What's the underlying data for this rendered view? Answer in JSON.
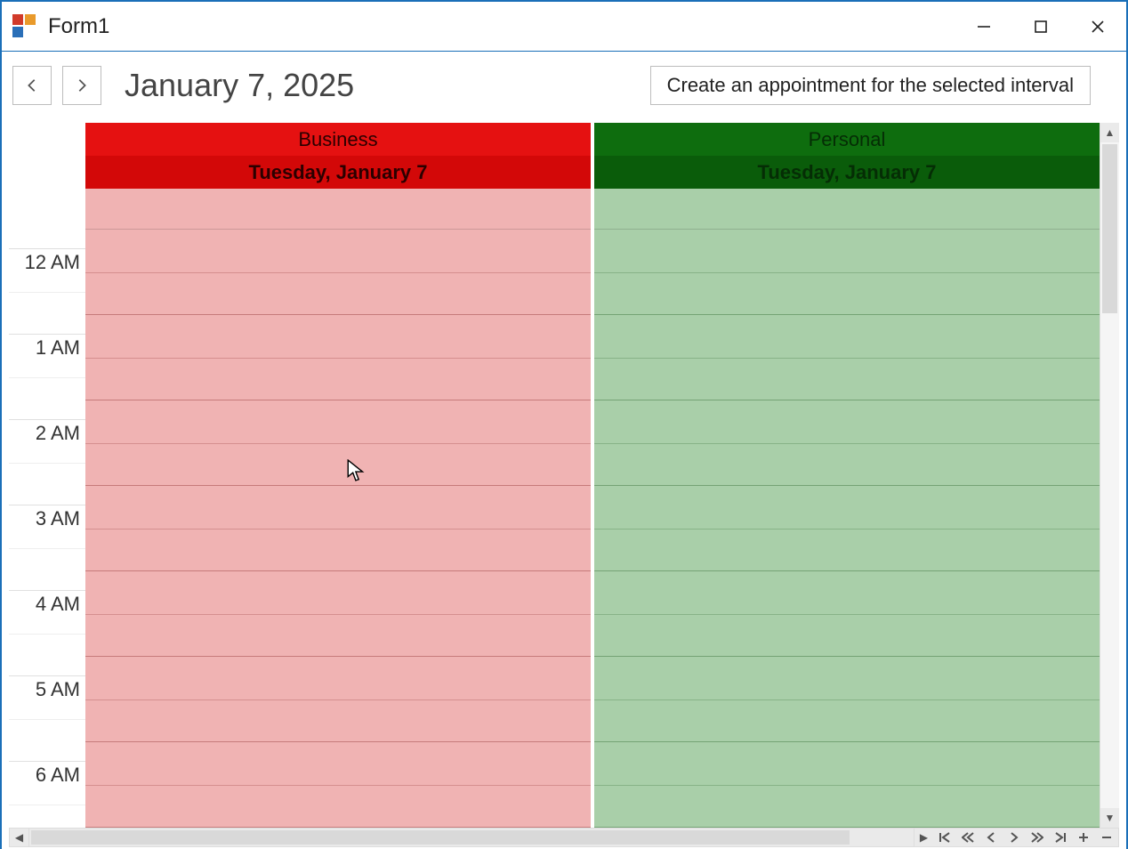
{
  "window": {
    "title": "Form1"
  },
  "toolbar": {
    "date_title": "January 7, 2025",
    "create_button": "Create an appointment for the selected interval"
  },
  "scheduler": {
    "time_labels": [
      "12 AM",
      "1 AM",
      "2 AM",
      "3 AM",
      "4 AM",
      "5 AM",
      "6 AM"
    ],
    "resources": [
      {
        "name": "Business",
        "date_header": "Tuesday, January 7",
        "color_header": "#e51111",
        "color_body": "#f0b3b3"
      },
      {
        "name": "Personal",
        "date_header": "Tuesday, January 7",
        "color_header": "#0e6d0e",
        "color_body": "#a9cfa9"
      }
    ]
  }
}
